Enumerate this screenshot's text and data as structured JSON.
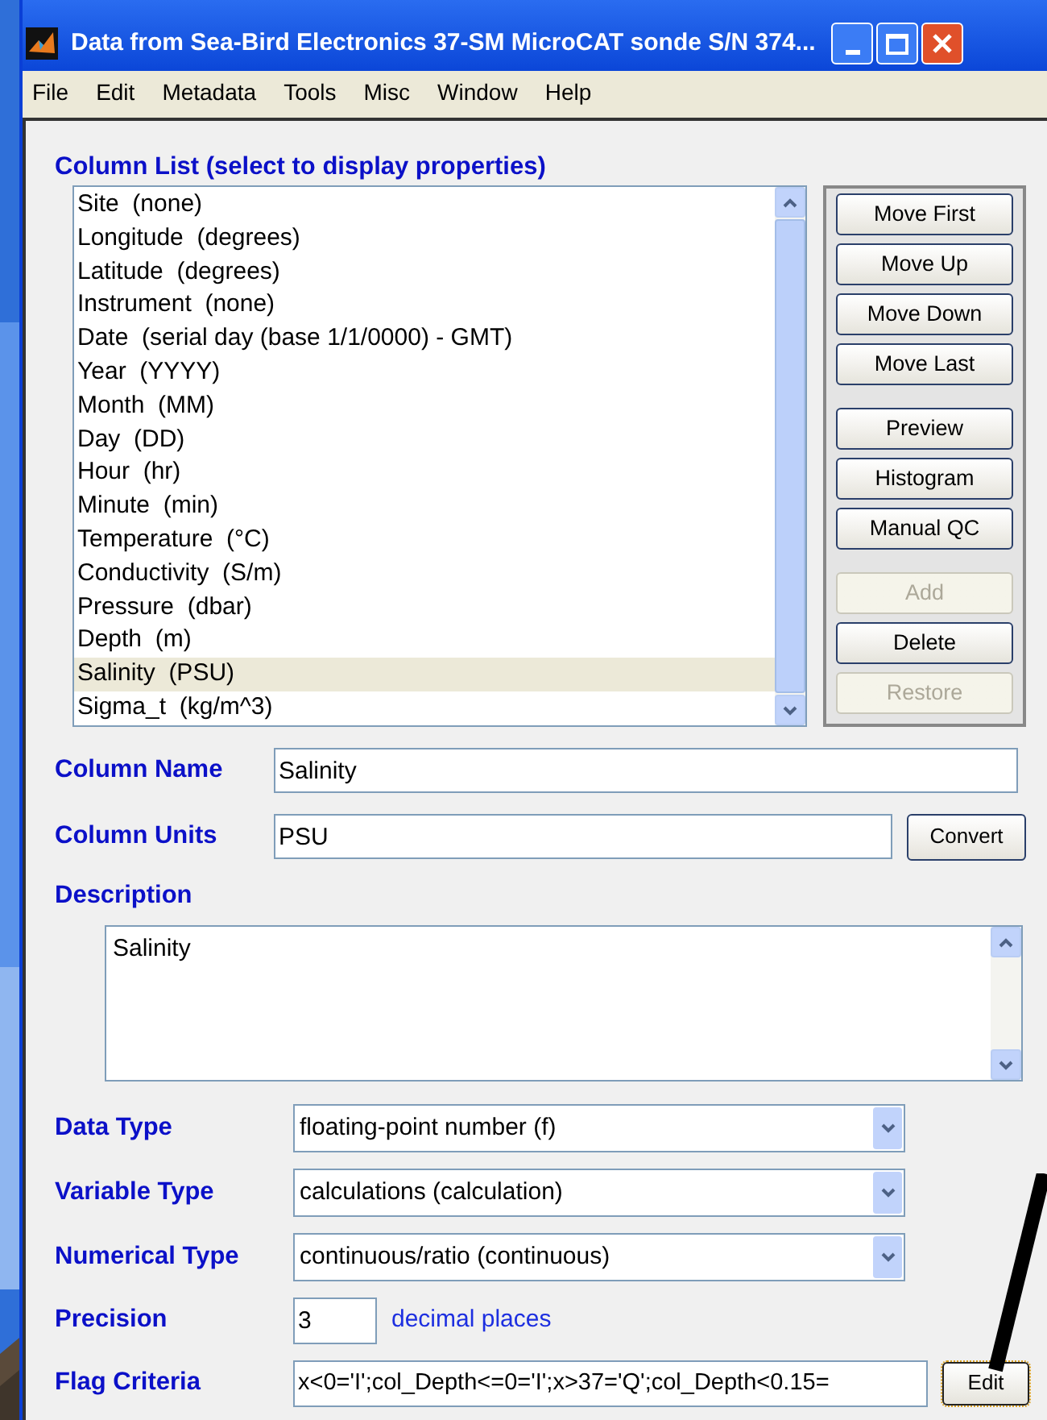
{
  "window": {
    "title": "Data from Sea-Bird Electronics 37-SM MicroCAT sonde S/N 374..."
  },
  "menu": [
    "File",
    "Edit",
    "Metadata",
    "Tools",
    "Misc",
    "Window",
    "Help"
  ],
  "column_list": {
    "label": "Column List (select to display properties)",
    "items": [
      {
        "text": "Site  (none)",
        "selected": false
      },
      {
        "text": "Longitude  (degrees)",
        "selected": false
      },
      {
        "text": "Latitude  (degrees)",
        "selected": false
      },
      {
        "text": "Instrument  (none)",
        "selected": false
      },
      {
        "text": "Date  (serial day (base 1/1/0000) - GMT)",
        "selected": false
      },
      {
        "text": "Year  (YYYY)",
        "selected": false
      },
      {
        "text": "Month  (MM)",
        "selected": false
      },
      {
        "text": "Day  (DD)",
        "selected": false
      },
      {
        "text": "Hour  (hr)",
        "selected": false
      },
      {
        "text": "Minute  (min)",
        "selected": false
      },
      {
        "text": "Temperature  (°C)",
        "selected": false
      },
      {
        "text": "Conductivity  (S/m)",
        "selected": false
      },
      {
        "text": "Pressure  (dbar)",
        "selected": false
      },
      {
        "text": "Depth  (m)",
        "selected": false
      },
      {
        "text": "Salinity  (PSU)",
        "selected": true
      },
      {
        "text": "Sigma_t  (kg/m^3)",
        "selected": false
      }
    ]
  },
  "list_buttons": [
    {
      "label": "Move First",
      "disabled": false,
      "group_start": false
    },
    {
      "label": "Move Up",
      "disabled": false,
      "group_start": false
    },
    {
      "label": "Move Down",
      "disabled": false,
      "group_start": false
    },
    {
      "label": "Move Last",
      "disabled": false,
      "group_start": false
    },
    {
      "label": "Preview",
      "disabled": false,
      "group_start": true
    },
    {
      "label": "Histogram",
      "disabled": false,
      "group_start": false
    },
    {
      "label": "Manual QC",
      "disabled": false,
      "group_start": false
    },
    {
      "label": "Add",
      "disabled": true,
      "group_start": true
    },
    {
      "label": "Delete",
      "disabled": false,
      "group_start": false
    },
    {
      "label": "Restore",
      "disabled": true,
      "group_start": false
    }
  ],
  "column_name": {
    "label": "Column Name",
    "value": "Salinity"
  },
  "column_units": {
    "label": "Column Units",
    "value": "PSU",
    "button": "Convert"
  },
  "description": {
    "label": "Description",
    "value": "Salinity"
  },
  "data_type": {
    "label": "Data Type",
    "value": "floating-point number (f)"
  },
  "variable_type": {
    "label": "Variable Type",
    "value": "calculations (calculation)"
  },
  "numerical_type": {
    "label": "Numerical Type",
    "value": "continuous/ratio (continuous)"
  },
  "precision": {
    "label": "Precision",
    "value": "3",
    "suffix": "decimal places"
  },
  "flag_criteria": {
    "label": "Flag Criteria",
    "value": "x<0='I';col_Depth<=0='I';x>37='Q';col_Depth<0.15=",
    "button": "Edit"
  }
}
